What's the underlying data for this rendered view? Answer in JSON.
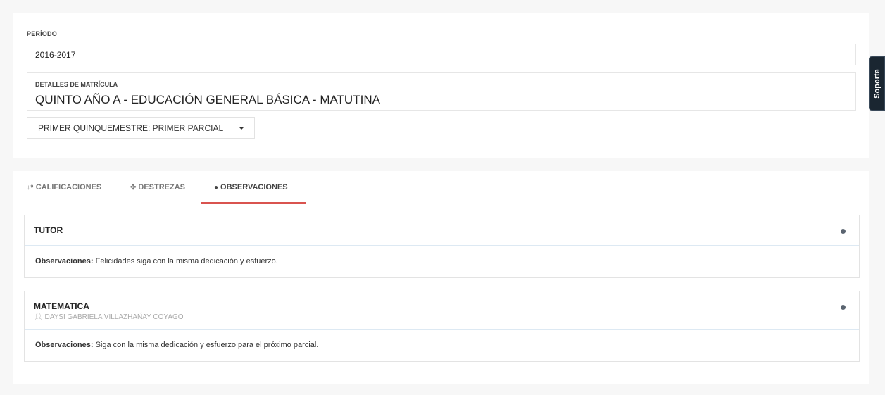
{
  "matricula": {
    "periodo_label": "PERÍODO",
    "periodo_value": "2016-2017",
    "detalles_label": "DETALLES DE MATRÍCULA",
    "detalles_value": "QUINTO AÑO A - EDUCACIÓN GENERAL BÁSICA - MATUTINA",
    "periodo_selector": "PRIMER QUINQUEMESTRE: PRIMER PARCIAL"
  },
  "soporte_label": "Soporte",
  "tabs": [
    {
      "label": "CALIFICACIONES",
      "icon": "sort-numeric-icon"
    },
    {
      "label": "DESTREZAS",
      "icon": "puzzle-icon"
    },
    {
      "label": "OBSERVACIONES",
      "icon": "comments-icon",
      "active": true
    }
  ],
  "accent_color": "#d9534f",
  "observaciones": [
    {
      "title": "TUTOR",
      "teacher": "",
      "label": "Observaciones:",
      "text": "Felicidades siga con la misma dedicación y esfuerzo."
    },
    {
      "title": "MATEMATICA",
      "teacher": "DAYSI GABRIELA VILLAZHAÑAY COYAGO",
      "label": "Observaciones:",
      "text": "Siga con la misma dedicación y esfuerzo para el próximo parcial."
    }
  ]
}
